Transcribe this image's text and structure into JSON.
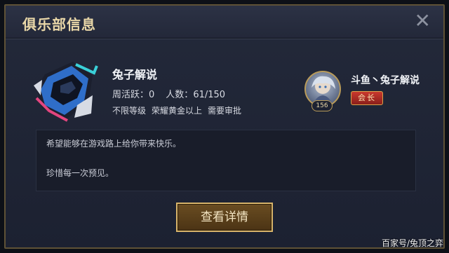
{
  "dialog": {
    "title": "俱乐部信息",
    "close_icon": "close-icon"
  },
  "club": {
    "logo_icon": "hooded-mask-logo-icon",
    "name": "兔子解说",
    "weekly_active_label": "周活跃：",
    "weekly_active_value": "0",
    "members_label": "人数：",
    "members_value": "61/150",
    "req_level": "不限等级",
    "req_rank": "荣耀黄金以上",
    "req_approval": "需要审批"
  },
  "leader": {
    "avatar_icon": "hero-avatar",
    "level": "156",
    "name": "斗鱼丶兔子解说",
    "role": "会长"
  },
  "description": {
    "line1": "希望能够在游戏路上给你带来快乐。",
    "line2": "珍惜每一次预见。"
  },
  "actions": {
    "details_label": "查看详情"
  },
  "watermark": "百家号/兔顶之弈",
  "colors": {
    "title_gold": "#e9d7a8",
    "panel_bg": "#23293a",
    "button_border": "#d8b46a",
    "role_badge_red": "#c9392e"
  }
}
